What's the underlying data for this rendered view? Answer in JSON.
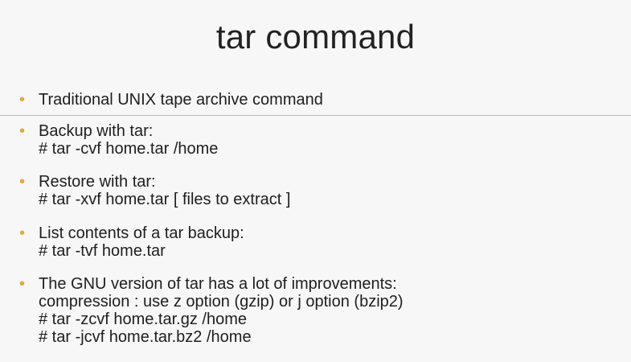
{
  "slide": {
    "title": "tar command",
    "accent_color": "#e0a93a",
    "bullet_marker": "•",
    "bullets": [
      {
        "lines": [
          "Traditional UNIX tape archive command"
        ]
      },
      {
        "lines": [
          "Backup with tar:",
          "# tar -cvf home.tar /home"
        ]
      },
      {
        "lines": [
          "Restore with tar:",
          "# tar -xvf home.tar [ files to extract ]"
        ]
      },
      {
        "lines": [
          "List contents of a tar backup:",
          "# tar -tvf home.tar"
        ]
      },
      {
        "lines": [
          "The GNU version of tar has a lot of improvements:",
          "compression : use z option (gzip) or j option (bzip2)",
          "# tar -zcvf home.tar.gz /home",
          "# tar -jcvf home.tar.bz2 /home"
        ]
      }
    ]
  }
}
